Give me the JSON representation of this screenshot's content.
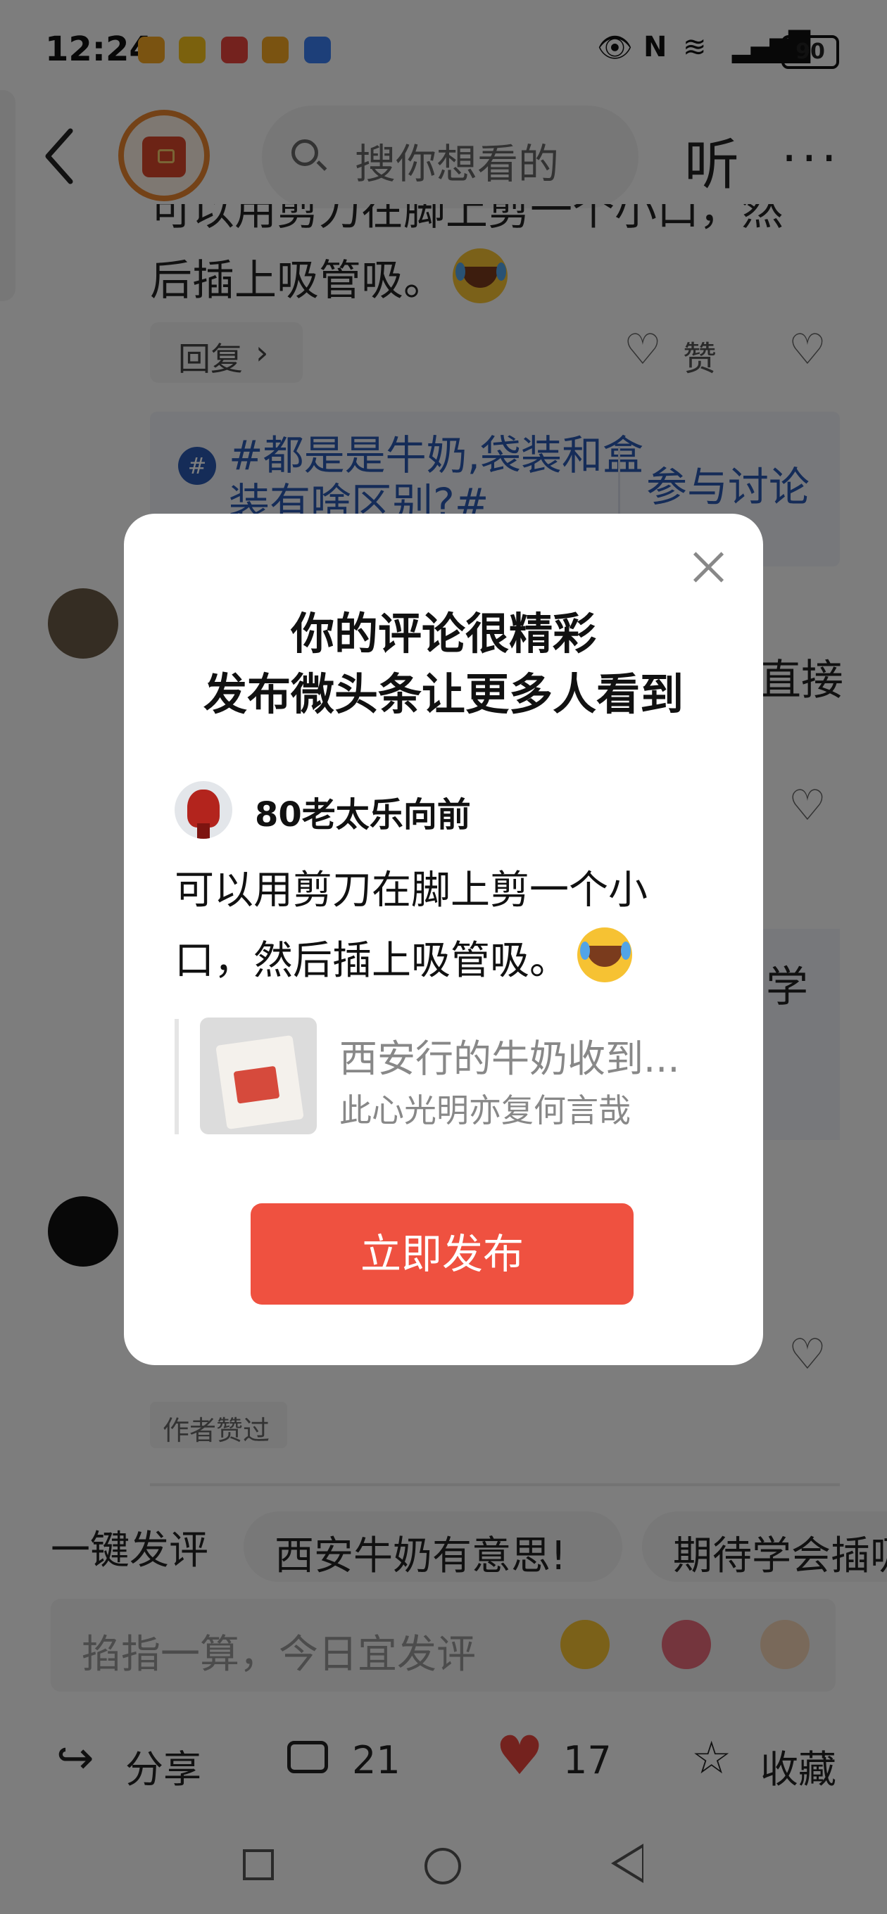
{
  "status_bar": {
    "time": "12:24",
    "app_icons": [
      "app-icon-orange",
      "meituan-icon",
      "red-app-icon",
      "app-icon-orange",
      "baidu-icon"
    ],
    "battery": "90"
  },
  "header": {
    "search_placeholder": "搜你想看的",
    "listen_label": "听",
    "more_label": "···"
  },
  "background": {
    "comment_fragment_line1": "可以用剪刀在脚上剪一个小口，然",
    "comment_fragment_line2": "后插上吸管吸。",
    "reply_label": "回复",
    "like_label": "赞",
    "topic_text": "#都是是牛奶,袋装和盒装有啥区别?#",
    "join_label": "参与讨论",
    "partial_right_1": "直接",
    "partial_right_2": "学",
    "author_liked_tag": "作者赞过"
  },
  "quick_comments": {
    "label": "一键发评",
    "items": [
      "西安牛奶有意思!",
      "期待学会插吸管"
    ]
  },
  "input_bar": {
    "placeholder": "掐指一算，今日宜发评"
  },
  "bottom_bar": {
    "share_label": "分享",
    "comment_count": "21",
    "like_count": "17",
    "favorite_label": "收藏"
  },
  "modal": {
    "title_line1": "你的评论很精彩",
    "title_line2": "发布微头条让更多人看到",
    "username": "80老太乐向前",
    "comment_text": "可以用剪刀在脚上剪一个小口，然后插上吸管吸。",
    "quoted_title": "西安行的牛奶收到...",
    "quoted_author": "此心光明亦复何言哉",
    "publish_label": "立即发布"
  }
}
